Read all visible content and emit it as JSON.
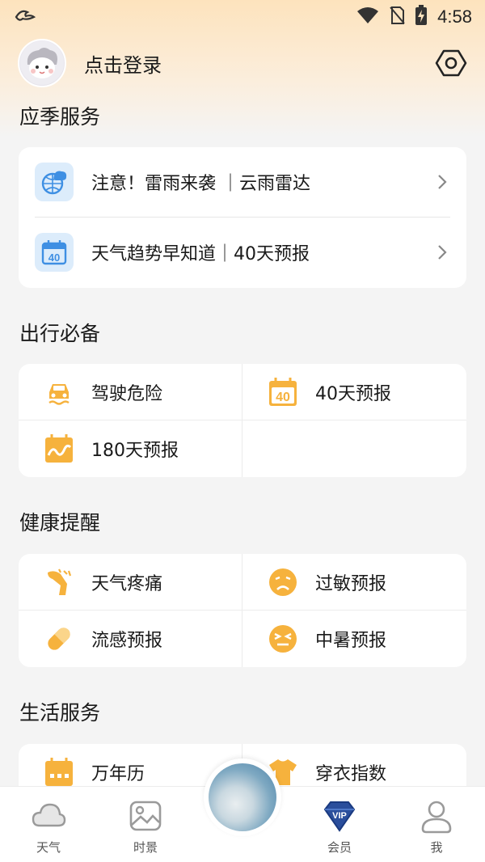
{
  "status_bar": {
    "time": "4:58",
    "icons": [
      "app-logo-icon",
      "wifi-icon",
      "no-sim-icon",
      "battery-charging-icon"
    ]
  },
  "header": {
    "login_label": "点击登录",
    "icons": [
      "avatar",
      "settings-icon"
    ]
  },
  "seasonal": {
    "title": "应季服务",
    "items": [
      {
        "label": "注意！雷雨来袭 ｜云雨雷达",
        "icon": "radar-globe-icon"
      },
      {
        "label": "天气趋势早知道｜40天预报",
        "icon": "calendar-40-icon"
      }
    ]
  },
  "travel": {
    "title": "出行必备",
    "items": [
      {
        "label": "驾驶危险",
        "icon": "car-skid-icon"
      },
      {
        "label": "40天预报",
        "icon": "calendar-40-icon"
      },
      {
        "label": "180天预报",
        "icon": "calendar-trend-icon"
      }
    ]
  },
  "health": {
    "title": "健康提醒",
    "items": [
      {
        "label": "天气疼痛",
        "icon": "joint-pain-icon"
      },
      {
        "label": "过敏预报",
        "icon": "sad-face-icon"
      },
      {
        "label": "流感预报",
        "icon": "pill-icon"
      },
      {
        "label": "中暑预报",
        "icon": "dizzy-face-icon"
      }
    ]
  },
  "life": {
    "title": "生活服务",
    "items": [
      {
        "label": "万年历",
        "icon": "calendar-icon"
      },
      {
        "label": "穿衣指数",
        "icon": "tshirt-icon"
      }
    ]
  },
  "bottom_nav": {
    "items": [
      {
        "label": "天气",
        "icon": "cloud-icon"
      },
      {
        "label": "时景",
        "icon": "picture-icon"
      },
      {
        "label": "会员",
        "icon": "vip-diamond-icon"
      },
      {
        "label": "我",
        "icon": "user-icon"
      }
    ]
  },
  "colors": {
    "accent_orange": "#f6b23d",
    "accent_blue": "#3e8fe3",
    "header_gradient_top": "#fde3bd"
  }
}
